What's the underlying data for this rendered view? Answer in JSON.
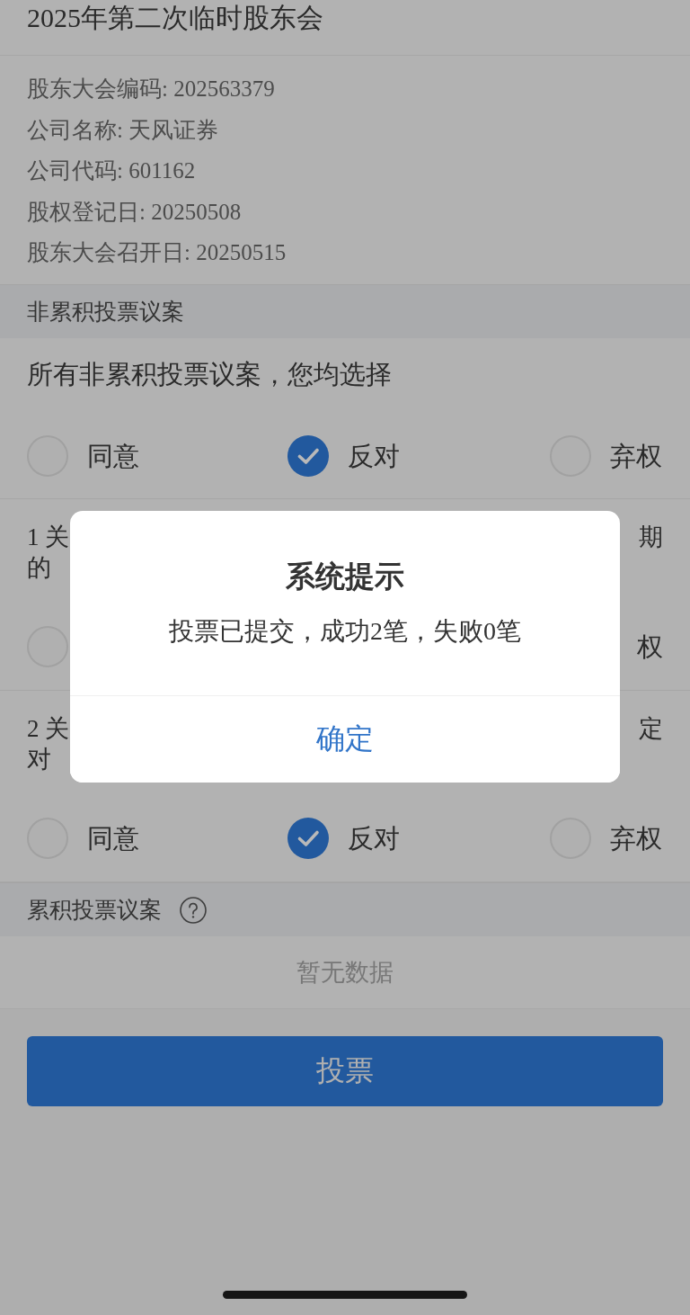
{
  "header": {
    "title": "2025年第二次临时股东会"
  },
  "meeting_info": [
    "股东大会编码: 202563379",
    "公司名称: 天风证券",
    "公司代码: 601162",
    "股权登记日: 20250508",
    "股东大会召开日: 20250515"
  ],
  "non_cumulative": {
    "heading": "非累积投票议案",
    "bulk": {
      "prompt": "所有非累积投票议案，您均选择",
      "options": [
        {
          "kind": "option",
          "label": "同意",
          "selected": false
        },
        {
          "kind": "option",
          "label": "反对",
          "selected": true
        },
        {
          "kind": "option",
          "label": "弃权",
          "selected": false
        }
      ]
    },
    "proposals": [
      {
        "title_lines": [
          {
            "left": "1 关",
            "right": "期"
          },
          {
            "left": "的"
          }
        ],
        "options": [
          {
            "kind": "radio",
            "selected": false
          },
          {
            "kind": "label",
            "label": "权"
          }
        ]
      },
      {
        "title_lines": [
          {
            "left": "2 关",
            "right": "定"
          },
          {
            "left": "对"
          }
        ],
        "options": [
          {
            "kind": "option",
            "label": "同意",
            "selected": false
          },
          {
            "kind": "option",
            "label": "反对",
            "selected": true
          },
          {
            "kind": "option",
            "label": "弃权",
            "selected": false
          }
        ]
      }
    ]
  },
  "cumulative": {
    "heading": "累积投票议案",
    "empty_text": "暂无数据"
  },
  "vote_button": {
    "label": "投票"
  },
  "dialog": {
    "title": "系统提示",
    "message": "投票已提交，成功2笔，失败0笔",
    "button": "确定"
  }
}
